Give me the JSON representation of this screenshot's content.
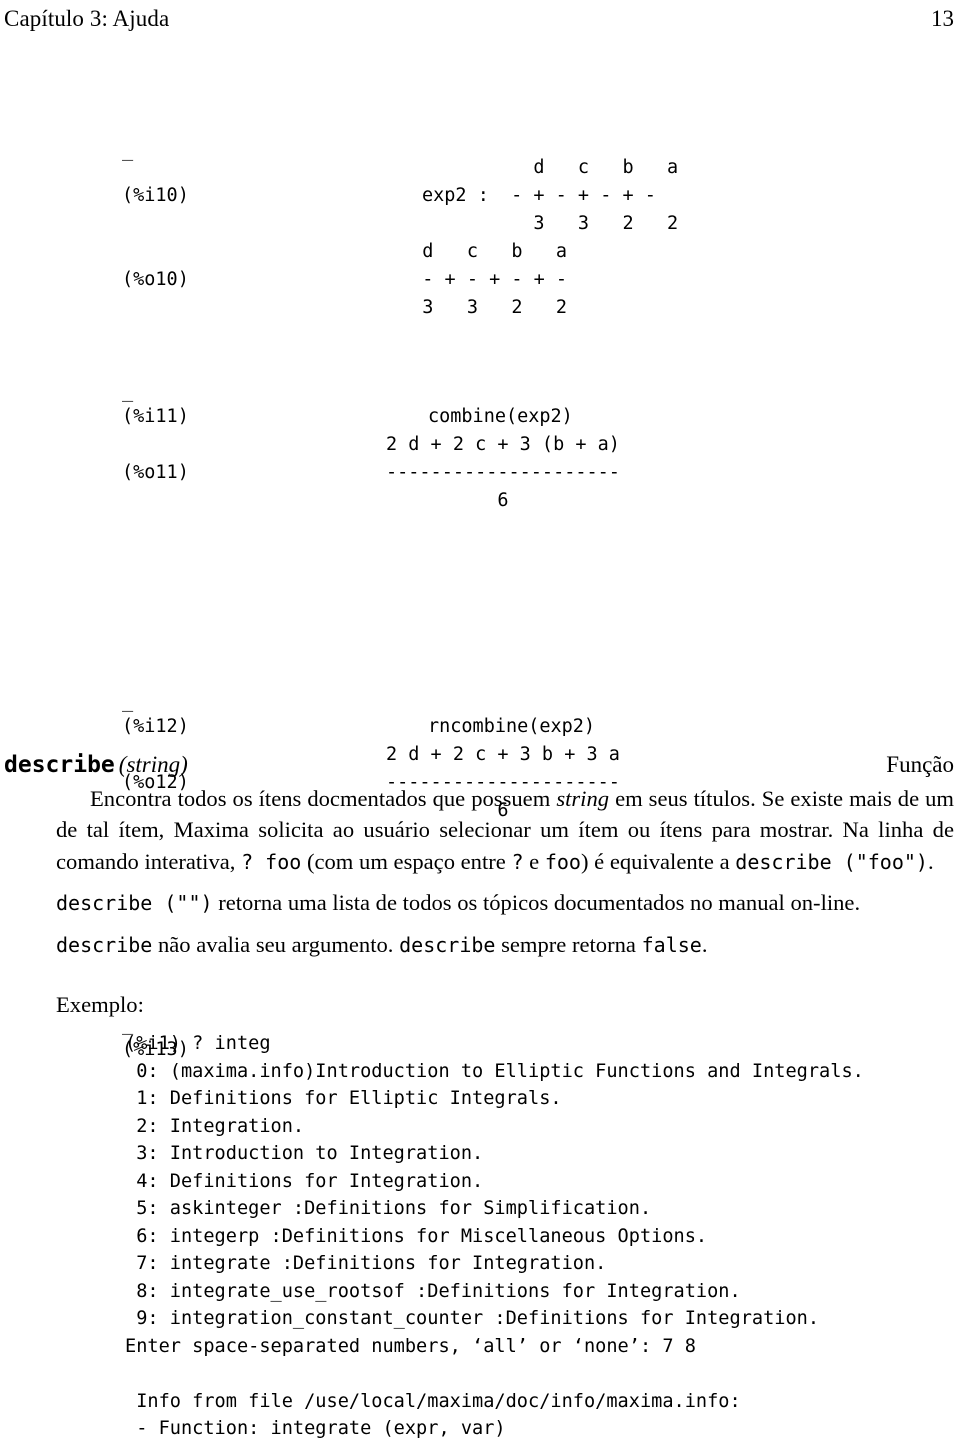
{
  "header": {
    "title": "Capítulo 3: Ajuda",
    "page_number": "13"
  },
  "session_top": {
    "blocks": [
      {
        "continuation_dash": "_",
        "input_label": "(%i10)",
        "output_label": "(%o10)",
        "input_lines": [
          "          d   c   b   a",
          "exp2 :  - + - + - + -",
          "          3   3   2   2"
        ],
        "output_lines": [
          "  d   c   b   a",
          "  - + - + - + -",
          "  3   3   2   2"
        ]
      },
      {
        "continuation_dash": "_",
        "input_label": "(%i11)",
        "output_label": "(%o11)",
        "input_lines": [
          "combine(exp2)"
        ],
        "output_lines": [
          "2 d + 2 c + 3 (b + a)",
          "---------------------",
          "          6"
        ]
      },
      {
        "continuation_dash": "_",
        "input_label": "(%i12)",
        "output_label": "(%o12)",
        "input_lines": [
          "rncombine(exp2)"
        ],
        "output_lines": [
          "2 d + 2 c + 3 b + 3 a",
          "---------------------",
          "          6"
        ]
      },
      {
        "continuation_dash": "_",
        "input_label": "(%i13)",
        "output_label": "",
        "input_lines": [],
        "output_lines": []
      }
    ]
  },
  "definition": {
    "name": "describe",
    "arguments": "(string)",
    "category": "Função"
  },
  "body": {
    "paragraph_1_part_1": "Encontra todos os ítens docmentados que possuem ",
    "paragraph_1_italic": "string",
    "paragraph_1_part_2": " em seus títulos. Se existe mais de um de tal ítem, Maxima solicita ao usuário selecionar um ítem ou ítens para mostrar. Na linha de comando interativa, ",
    "paragraph_1_code_1": "? foo",
    "paragraph_1_part_3": " (com um espaço entre ",
    "paragraph_1_code_2": "?",
    "paragraph_1_part_4": " e ",
    "paragraph_1_code_3": "foo",
    "paragraph_1_part_5": ") é equivalente a ",
    "paragraph_1_code_4": "describe (\"foo\")",
    "paragraph_1_part_6": ".",
    "paragraph_2_code_1": "describe (\"\")",
    "paragraph_2_part_1": " retorna uma lista de todos os tópicos documentados no manual on-line.",
    "paragraph_3_code_1": "describe",
    "paragraph_3_part_1": " não avalia seu argumento. ",
    "paragraph_3_code_2": "describe",
    "paragraph_3_part_2": " sempre retorna ",
    "paragraph_3_code_3": "false",
    "paragraph_3_part_3": ".",
    "exemplo_label": "Exemplo:"
  },
  "example": {
    "lines": [
      "(%i1) ? integ",
      " 0: (maxima.info)Introduction to Elliptic Functions and Integrals.",
      " 1: Definitions for Elliptic Integrals.",
      " 2: Integration.",
      " 3: Introduction to Integration.",
      " 4: Definitions for Integration.",
      " 5: askinteger :Definitions for Simplification.",
      " 6: integerp :Definitions for Miscellaneous Options.",
      " 7: integrate :Definitions for Integration.",
      " 8: integrate_use_rootsof :Definitions for Integration.",
      " 9: integration_constant_counter :Definitions for Integration.",
      "Enter space-separated numbers, ‘all’ or ‘none’: 7 8",
      "",
      " Info from file /use/local/maxima/doc/info/maxima.info:",
      " - Function: integrate (expr, var)"
    ]
  }
}
